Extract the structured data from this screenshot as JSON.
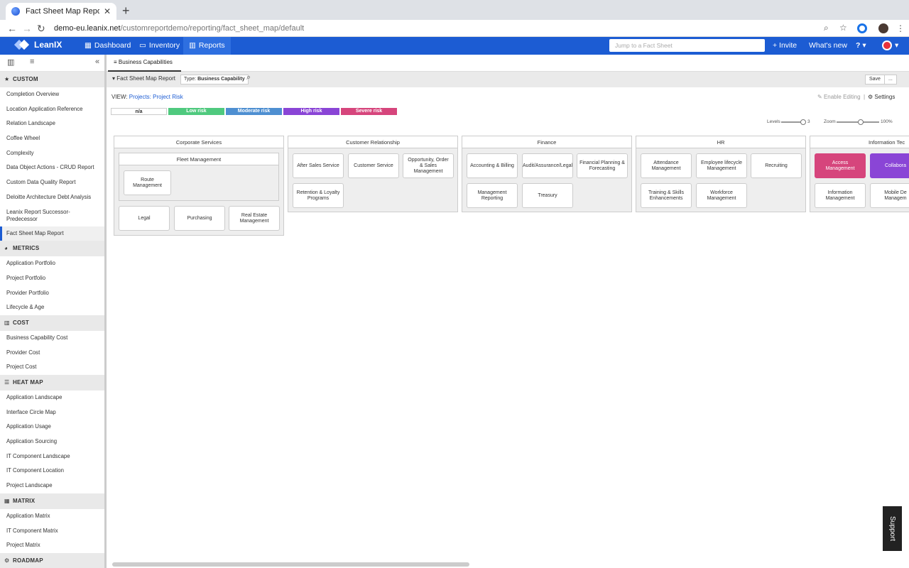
{
  "browser": {
    "tab_title": "Fact Sheet Map Report | LeanIX",
    "url_host": "demo-eu.leanix.net",
    "url_path": "/customreportdemo/reporting/fact_sheet_map/default"
  },
  "header": {
    "brand": "LeanIX",
    "nav": [
      {
        "label": "Dashboard",
        "icon": "grid-icon"
      },
      {
        "label": "Inventory",
        "icon": "box-icon"
      },
      {
        "label": "Reports",
        "icon": "chart-icon"
      }
    ],
    "search_placeholder": "Jump to a Fact Sheet",
    "invite": "+ Invite",
    "whats_new": "What's new",
    "help": "?"
  },
  "sidebar": {
    "groups": [
      {
        "title": "CUSTOM",
        "icon": "★",
        "items": [
          "Completion Overview",
          "Location Application Reference",
          "Relation Landscape",
          "Coffee Wheel",
          "Complexity",
          "Data Object Actions - CRUD Report",
          "Custom Data Quality Report",
          "Deloitte Architecture Debt Analysis",
          "Leanix Report Successor-Predecessor",
          "Fact Sheet Map Report"
        ]
      },
      {
        "title": "METRICS",
        "icon": "◕",
        "items": [
          "Application Portfolio",
          "Project Portfolio",
          "Provider Portfolio",
          "Lifecycle & Age"
        ]
      },
      {
        "title": "COST",
        "icon": "▥",
        "items": [
          "Business Capability Cost",
          "Provider Cost",
          "Project Cost"
        ]
      },
      {
        "title": "HEAT MAP",
        "icon": "☰",
        "items": [
          "Application Landscape",
          "Interface Circle Map",
          "Application Usage",
          "Application Sourcing",
          "IT Component Landscape",
          "IT Component Location",
          "Project Landscape"
        ]
      },
      {
        "title": "MATRIX",
        "icon": "▦",
        "items": [
          "Application Matrix",
          "IT Component Matrix",
          "Project Matrix"
        ]
      },
      {
        "title": "ROADMAP",
        "icon": "⚙",
        "items": []
      }
    ]
  },
  "main": {
    "tab": "Business Capabilities",
    "report_name": "Fact Sheet Map Report",
    "type_label": "Type:",
    "type_value": "Business Capability",
    "save": "Save",
    "more": "...",
    "view_label": "VIEW:",
    "view_value": "Projects: Project Risk",
    "enable_editing": "Enable Editing",
    "settings": "Settings",
    "legend": [
      {
        "label": "n/a",
        "color": "#ffffff"
      },
      {
        "label": "Low risk",
        "color": "#4fc97e"
      },
      {
        "label": "Moderate risk",
        "color": "#4e8fd1"
      },
      {
        "label": "High risk",
        "color": "#8a45d6"
      },
      {
        "label": "Severe risk",
        "color": "#d6457c"
      }
    ],
    "levels_label": "Levels",
    "levels_value": "3",
    "zoom_label": "Zoom",
    "zoom_value": "100%",
    "categories": [
      {
        "title": "Corporate Services",
        "sub": "Fleet Management",
        "sub_items": [
          "Route Management"
        ],
        "items": [
          "Legal",
          "Purchasing",
          "Real Estate Management"
        ]
      },
      {
        "title": "Customer Relationship",
        "items": [
          "After Sales Service",
          "Customer Service",
          "Opportunity, Order & Sales Management",
          "Retention & Loyalty Programs"
        ]
      },
      {
        "title": "Finance",
        "items": [
          "Accounting & Billing",
          "Audit/Assurance/Legal",
          "Financial Planning & Forecasting",
          "Management Reporting",
          "Treasury"
        ]
      },
      {
        "title": "HR",
        "items": [
          "Attendance Management",
          "Employee lifecycle Management",
          "Recruiting",
          "Training & Skills Enhancements",
          "Workforce Management"
        ]
      },
      {
        "title": "Information Tec",
        "items": [
          "Access Management",
          "Collabora",
          "Information Management",
          "Mobile De Managem"
        ]
      }
    ],
    "support": "Support"
  }
}
